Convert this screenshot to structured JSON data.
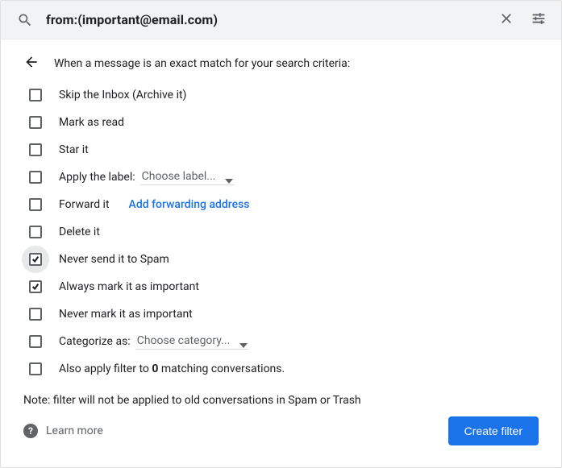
{
  "search": {
    "query": "from:(important@email.com)"
  },
  "header": "When a message is an exact match for your search criteria:",
  "options": {
    "skip_inbox": {
      "label": "Skip the Inbox (Archive it)",
      "checked": false
    },
    "mark_read": {
      "label": "Mark as read",
      "checked": false
    },
    "star": {
      "label": "Star it",
      "checked": false
    },
    "apply_label": {
      "label": "Apply the label:",
      "checked": false,
      "select": "Choose label..."
    },
    "forward": {
      "label": "Forward it",
      "checked": false,
      "link": "Add forwarding address"
    },
    "delete": {
      "label": "Delete it",
      "checked": false
    },
    "never_spam": {
      "label": "Never send it to Spam",
      "checked": true,
      "focused": true
    },
    "always_imp": {
      "label": "Always mark it as important",
      "checked": true
    },
    "never_imp": {
      "label": "Never mark it as important",
      "checked": false
    },
    "categorize": {
      "label": "Categorize as:",
      "checked": false,
      "select": "Choose category..."
    },
    "also_apply": {
      "prefix": "Also apply filter to ",
      "count": "0",
      "suffix": " matching conversations.",
      "checked": false
    }
  },
  "note": "Note: filter will not be applied to old conversations in Spam or Trash",
  "footer": {
    "learn_more": "Learn more",
    "create_filter": "Create filter"
  }
}
